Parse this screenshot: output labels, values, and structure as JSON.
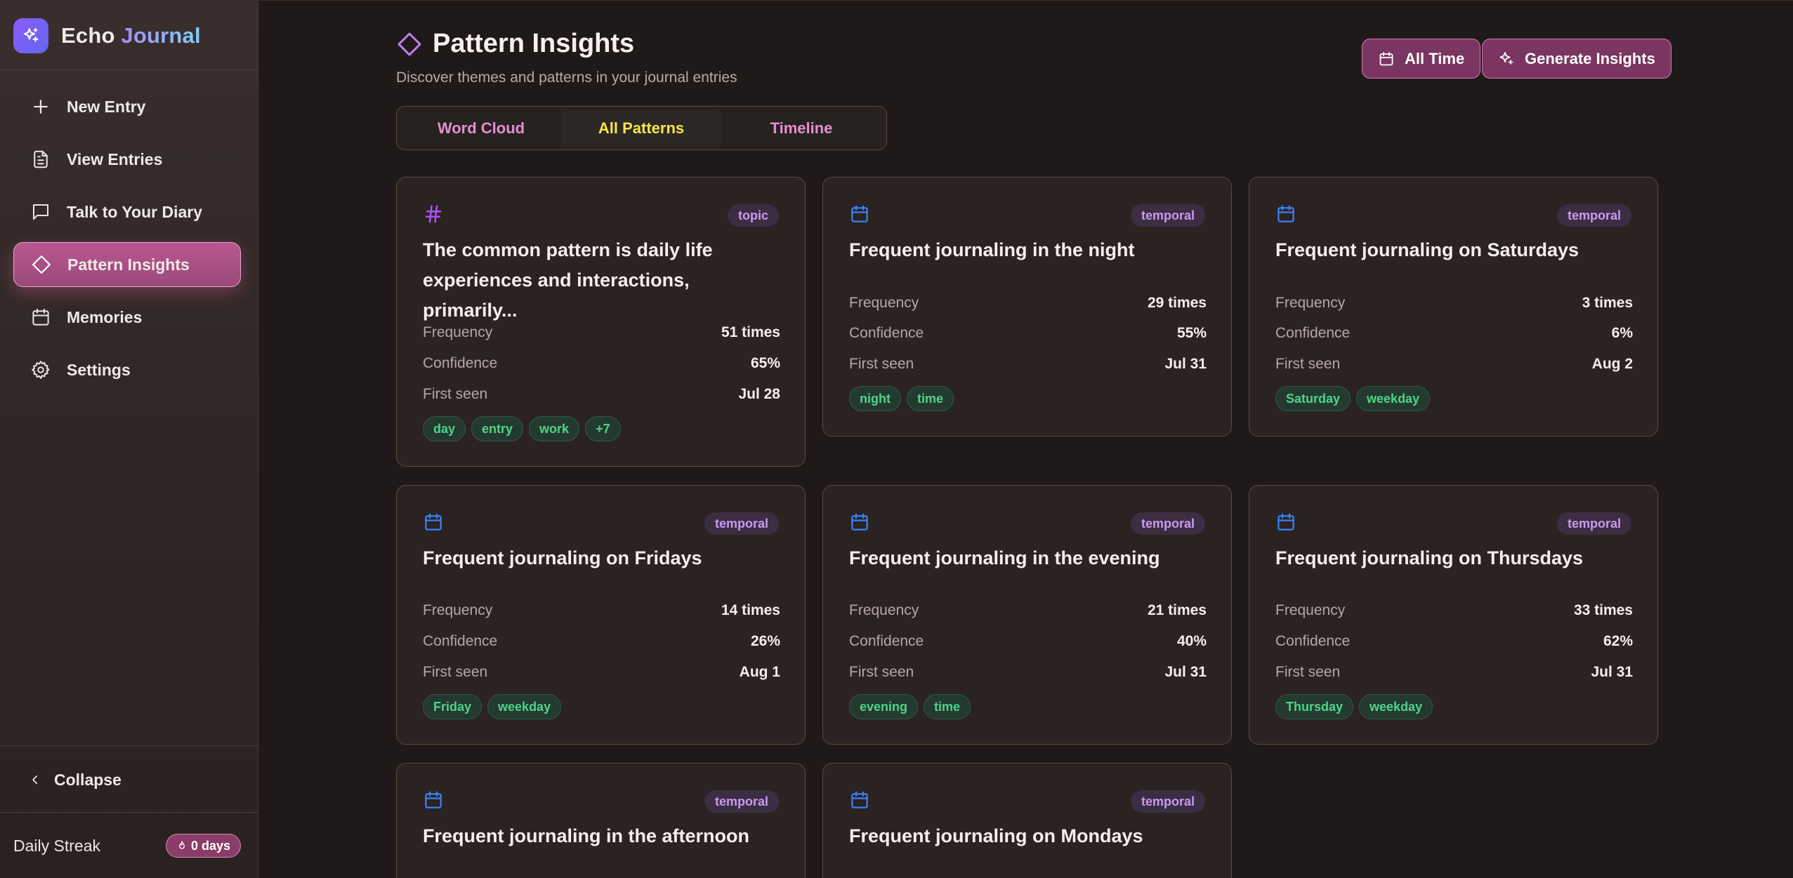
{
  "brand": {
    "name_a": "Echo",
    "name_b": "Journal"
  },
  "nav": [
    {
      "label": "New Entry",
      "icon": "plus-icon"
    },
    {
      "label": "View Entries",
      "icon": "document-icon"
    },
    {
      "label": "Talk to Your Diary",
      "icon": "chat-icon"
    },
    {
      "label": "Pattern Insights",
      "icon": "diamond-icon",
      "active": true
    },
    {
      "label": "Memories",
      "icon": "calendar-icon"
    },
    {
      "label": "Settings",
      "icon": "gear-icon"
    }
  ],
  "sidebar_footer": {
    "collapse_label": "Collapse",
    "streak_label": "Daily Streak",
    "streak_value": "0 days"
  },
  "header": {
    "title": "Pattern Insights",
    "subtitle": "Discover themes and patterns in your journal entries",
    "all_time_label": "All Time",
    "generate_label": "Generate Insights"
  },
  "tabs": [
    {
      "label": "Word Cloud"
    },
    {
      "label": "All Patterns",
      "active": true
    },
    {
      "label": "Timeline"
    }
  ],
  "labels": {
    "frequency": "Frequency",
    "confidence": "Confidence",
    "first_seen": "First seen"
  },
  "cards": [
    {
      "type": "topic",
      "icon": "hash-icon",
      "title": "The common pattern is daily life experiences and interactions, primarily...",
      "frequency": "51 times",
      "confidence": "65%",
      "first_seen": "Jul 28",
      "tags": [
        "day",
        "entry",
        "work",
        "+7"
      ]
    },
    {
      "type": "temporal",
      "icon": "calendar-icon",
      "title": "Frequent journaling in the night",
      "frequency": "29 times",
      "confidence": "55%",
      "first_seen": "Jul 31",
      "tags": [
        "night",
        "time"
      ]
    },
    {
      "type": "temporal",
      "icon": "calendar-icon",
      "title": "Frequent journaling on Saturdays",
      "frequency": "3 times",
      "confidence": "6%",
      "first_seen": "Aug 2",
      "tags": [
        "Saturday",
        "weekday"
      ]
    },
    {
      "type": "temporal",
      "icon": "calendar-icon",
      "title": "Frequent journaling on Fridays",
      "frequency": "14 times",
      "confidence": "26%",
      "first_seen": "Aug 1",
      "tags": [
        "Friday",
        "weekday"
      ]
    },
    {
      "type": "temporal",
      "icon": "calendar-icon",
      "title": "Frequent journaling in the evening",
      "frequency": "21 times",
      "confidence": "40%",
      "first_seen": "Jul 31",
      "tags": [
        "evening",
        "time"
      ]
    },
    {
      "type": "temporal",
      "icon": "calendar-icon",
      "title": "Frequent journaling on Thursdays",
      "frequency": "33 times",
      "confidence": "62%",
      "first_seen": "Jul 31",
      "tags": [
        "Thursday",
        "weekday"
      ]
    },
    {
      "type": "temporal",
      "icon": "calendar-icon",
      "title": "Frequent journaling in the afternoon"
    },
    {
      "type": "temporal",
      "icon": "calendar-icon",
      "title": "Frequent journaling on Mondays"
    }
  ]
}
